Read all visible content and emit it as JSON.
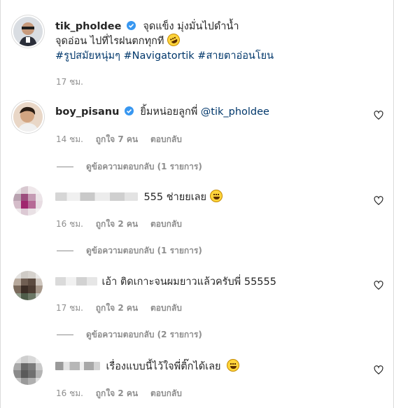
{
  "post": {
    "username": "tik_pholdee",
    "line1": "จุดแข็ง มุ่งมั่นไปดำน้ำ",
    "line2": "จุดอ่อน ไปที่ไรฝนตกทุกที",
    "hashtags": "#รูปสมัยหนุ่มๆ #Navigatortik #สายตาอ่อนโยน",
    "time": "17 ชม."
  },
  "comments": [
    {
      "username": "boy_pisanu",
      "text": "ยิ้มหน่อยลูกพี่",
      "mention": "@tik_pholdee",
      "time": "14 ชม.",
      "likes": "ถูกใจ 7 คน",
      "reply": "ตอบกลับ",
      "view_replies": "ดูข้อความตอบกลับ (1 รายการ)"
    },
    {
      "username_blurred": "blurred",
      "text": "555 ช่ายยเลย",
      "time": "16 ชม.",
      "likes": "ถูกใจ 2 คน",
      "reply": "ตอบกลับ",
      "view_replies": "ดูข้อความตอบกลับ (1 รายการ)"
    },
    {
      "username_blurred": "blurred",
      "text": "เอ้า ติดเกาะจนผมยาวแล้วครับพี่ 55555",
      "time": "17 ชม.",
      "likes": "ถูกใจ 2 คน",
      "reply": "ตอบกลับ",
      "view_replies": "ดูข้อความตอบกลับ (2 รายการ)"
    },
    {
      "username_blurred": "blurred",
      "text": "เรื่องแบบนี้ไว้ใจพี่ติ๊กได้เลย",
      "time": "16 ชม.",
      "likes": "ถูกใจ 2 คน",
      "reply": "ตอบกลับ"
    }
  ],
  "colors": {
    "link": "#00376b",
    "muted": "#8e8e8e",
    "verified": "#3897f0"
  },
  "icons": {
    "verified": "verified-badge-icon",
    "heart": "heart-outline-icon",
    "emoji_laugh": "grinning-sweat-emoji",
    "emoji_rofl": "rolling-laughing-emoji"
  }
}
